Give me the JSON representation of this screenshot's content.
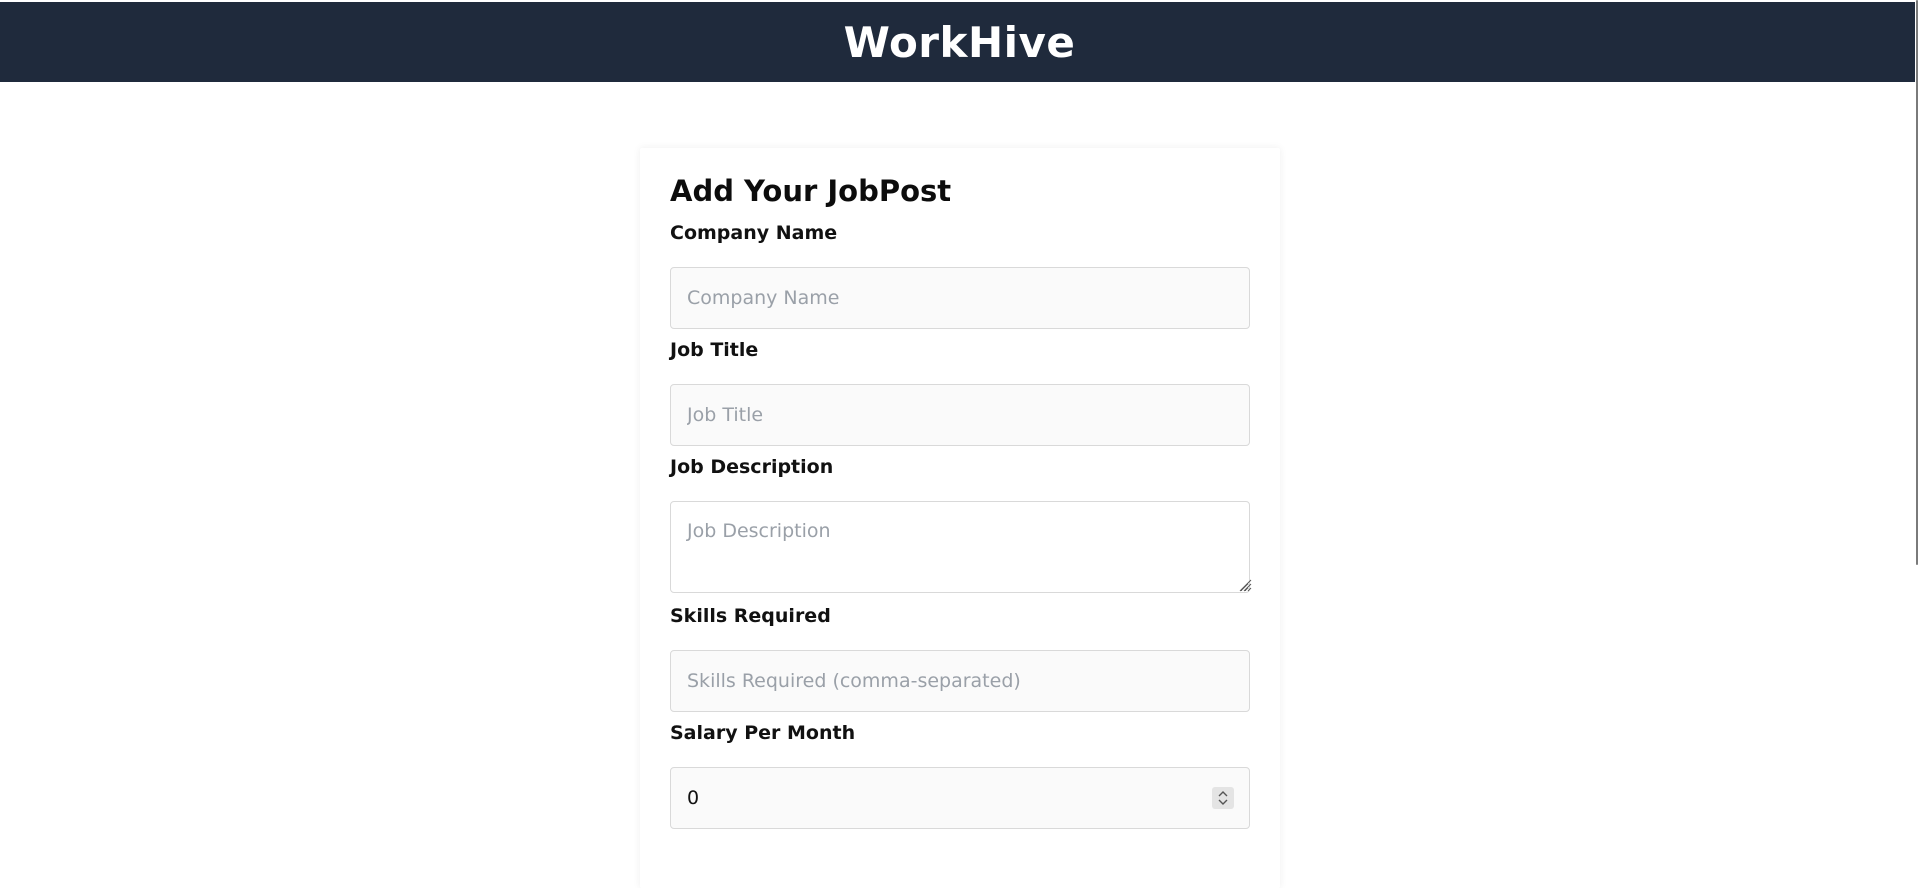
{
  "header": {
    "brand": "WorkHive",
    "bg_color": "#1f2a3c"
  },
  "form": {
    "title": "Add Your JobPost",
    "fields": {
      "company_name": {
        "label": "Company Name",
        "placeholder": "Company Name",
        "value": ""
      },
      "job_title": {
        "label": "Job Title",
        "placeholder": "Job Title",
        "value": ""
      },
      "job_description": {
        "label": "Job Description",
        "placeholder": "Job Description",
        "value": ""
      },
      "skills_required": {
        "label": "Skills Required",
        "placeholder": "Skills Required (comma-separated)",
        "value": ""
      },
      "salary_per_month": {
        "label": "Salary Per Month",
        "value": "0"
      }
    }
  },
  "icons": {
    "spinner": "chevron-up-down-icon",
    "resize": "resize-grip-icon"
  }
}
